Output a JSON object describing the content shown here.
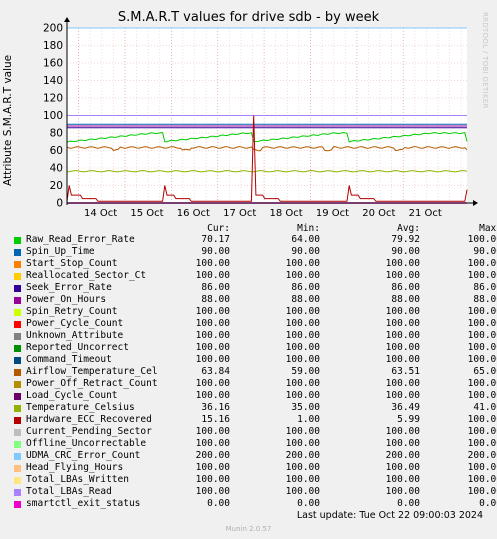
{
  "title": "S.M.A.R.T values for drive sdb - by week",
  "watermark": "RRDTOOL / TOBI OETIKER",
  "chart_data": {
    "type": "line",
    "ylabel": "Attribute S.M.A.R.T value",
    "ylim": [
      0,
      200
    ],
    "yticks": [
      0,
      20,
      40,
      60,
      80,
      100,
      120,
      140,
      160,
      180,
      200
    ],
    "xlim": [
      "2024-10-13T18:00",
      "2024-10-22T09:00"
    ],
    "xticks": [
      {
        "t": "2024-10-14T00:00",
        "label": "14 Oct"
      },
      {
        "t": "2024-10-15T00:00",
        "label": "15 Oct"
      },
      {
        "t": "2024-10-16T00:00",
        "label": "16 Oct"
      },
      {
        "t": "2024-10-17T00:00",
        "label": "17 Oct"
      },
      {
        "t": "2024-10-18T00:00",
        "label": "18 Oct"
      },
      {
        "t": "2024-10-19T00:00",
        "label": "19 Oct"
      },
      {
        "t": "2024-10-20T00:00",
        "label": "20 Oct"
      },
      {
        "t": "2024-10-21T00:00",
        "label": "21 Oct"
      }
    ],
    "grid": true,
    "columns": [
      "Cur:",
      "Min:",
      "Avg:",
      "Max:"
    ],
    "series": [
      {
        "name": "Raw_Read_Error_Rate",
        "color": "#00cc00",
        "cur": "70.17",
        "min": "64.00",
        "avg": "79.92",
        "max": "100.00"
      },
      {
        "name": "Spin_Up_Time",
        "color": "#0066b3",
        "cur": "90.00",
        "min": "90.00",
        "avg": "90.00",
        "max": "90.00"
      },
      {
        "name": "Start_Stop_Count",
        "color": "#ff8000",
        "cur": "100.00",
        "min": "100.00",
        "avg": "100.00",
        "max": "100.00"
      },
      {
        "name": "Reallocated_Sector_Ct",
        "color": "#ffcc00",
        "cur": "100.00",
        "min": "100.00",
        "avg": "100.00",
        "max": "100.00"
      },
      {
        "name": "Seek_Error_Rate",
        "color": "#330099",
        "cur": "86.00",
        "min": "86.00",
        "avg": "86.00",
        "max": "86.00"
      },
      {
        "name": "Power_On_Hours",
        "color": "#990099",
        "cur": "88.00",
        "min": "88.00",
        "avg": "88.00",
        "max": "88.00"
      },
      {
        "name": "Spin_Retry_Count",
        "color": "#ccff00",
        "cur": "100.00",
        "min": "100.00",
        "avg": "100.00",
        "max": "100.00"
      },
      {
        "name": "Power_Cycle_Count",
        "color": "#ff0000",
        "cur": "100.00",
        "min": "100.00",
        "avg": "100.00",
        "max": "100.00"
      },
      {
        "name": "Unknown_Attribute",
        "color": "#808080",
        "cur": "100.00",
        "min": "100.00",
        "avg": "100.00",
        "max": "100.00"
      },
      {
        "name": "Reported_Uncorrect",
        "color": "#008f00",
        "cur": "100.00",
        "min": "100.00",
        "avg": "100.00",
        "max": "100.00"
      },
      {
        "name": "Command_Timeout",
        "color": "#00487d",
        "cur": "100.00",
        "min": "100.00",
        "avg": "100.00",
        "max": "100.00"
      },
      {
        "name": "Airflow_Temperature_Cel",
        "color": "#b35a00",
        "cur": "63.84",
        "min": "59.00",
        "avg": "63.51",
        "max": "65.00"
      },
      {
        "name": "Power_Off_Retract_Count",
        "color": "#b38f00",
        "cur": "100.00",
        "min": "100.00",
        "avg": "100.00",
        "max": "100.00"
      },
      {
        "name": "Load_Cycle_Count",
        "color": "#6b006b",
        "cur": "100.00",
        "min": "100.00",
        "avg": "100.00",
        "max": "100.00"
      },
      {
        "name": "Temperature_Celsius",
        "color": "#8fb300",
        "cur": "36.16",
        "min": "35.00",
        "avg": "36.49",
        "max": "41.00"
      },
      {
        "name": "Hardware_ECC_Recovered",
        "color": "#b30000",
        "cur": "15.16",
        "min": "1.00",
        "avg": "5.99",
        "max": "100.00"
      },
      {
        "name": "Current_Pending_Sector",
        "color": "#bebebe",
        "cur": "100.00",
        "min": "100.00",
        "avg": "100.00",
        "max": "100.00"
      },
      {
        "name": "Offline_Uncorrectable",
        "color": "#80ff80",
        "cur": "100.00",
        "min": "100.00",
        "avg": "100.00",
        "max": "100.00"
      },
      {
        "name": "UDMA_CRC_Error_Count",
        "color": "#80c9ff",
        "cur": "200.00",
        "min": "200.00",
        "avg": "200.00",
        "max": "200.00"
      },
      {
        "name": "Head_Flying_Hours",
        "color": "#ffc080",
        "cur": "100.00",
        "min": "100.00",
        "avg": "100.00",
        "max": "100.00"
      },
      {
        "name": "Total_LBAs_Written",
        "color": "#ffe680",
        "cur": "100.00",
        "min": "100.00",
        "avg": "100.00",
        "max": "100.00"
      },
      {
        "name": "Total_LBAs_Read",
        "color": "#aa80ff",
        "cur": "100.00",
        "min": "100.00",
        "avg": "100.00",
        "max": "100.00"
      },
      {
        "name": "smartctl_exit_status",
        "color": "#ee00cc",
        "cur": "0.00",
        "min": "0.00",
        "avg": "0.00",
        "max": "0.00"
      }
    ]
  },
  "footer": {
    "last_update": "Last update: Tue Oct 22 09:00:03 2024",
    "version": "Munin 2.0.57"
  }
}
